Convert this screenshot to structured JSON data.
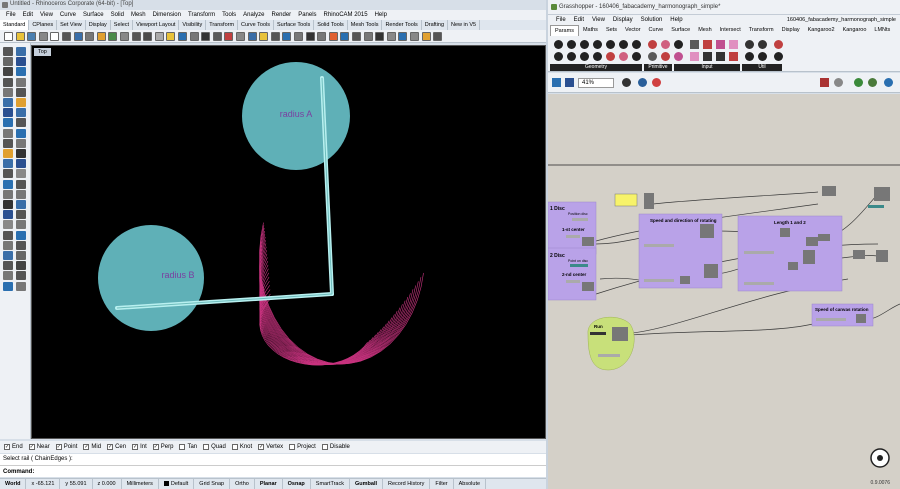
{
  "rhino": {
    "title": "Untitled - Rhinoceros Corporate (64-bit) - [Top]",
    "menu": [
      "File",
      "Edit",
      "View",
      "Curve",
      "Surface",
      "Solid",
      "Mesh",
      "Dimension",
      "Transform",
      "Tools",
      "Analyze",
      "Render",
      "Panels",
      "RhinoCAM 2015",
      "Help"
    ],
    "tabs": [
      "Standard",
      "CPlanes",
      "Set View",
      "Display",
      "Select",
      "Viewport Layout",
      "Visibility",
      "Transform",
      "Curve Tools",
      "Surface Tools",
      "Solid Tools",
      "Mesh Tools",
      "Render Tools",
      "Drafting",
      "New in V5"
    ],
    "active_tab": "Standard",
    "viewport_label": "Top",
    "circle_a_label": "radius A",
    "circle_b_label": "radius B",
    "osnaps": [
      {
        "label": "End",
        "checked": true
      },
      {
        "label": "Near",
        "checked": true
      },
      {
        "label": "Point",
        "checked": true
      },
      {
        "label": "Mid",
        "checked": true
      },
      {
        "label": "Cen",
        "checked": true
      },
      {
        "label": "Int",
        "checked": true
      },
      {
        "label": "Perp",
        "checked": true
      },
      {
        "label": "Tan",
        "checked": false
      },
      {
        "label": "Quad",
        "checked": false
      },
      {
        "label": "Knot",
        "checked": false
      },
      {
        "label": "Vertex",
        "checked": true
      },
      {
        "label": "Project",
        "checked": false
      },
      {
        "label": "Disable",
        "checked": false
      }
    ],
    "command_history": "Select rail ( ChainEdges ):",
    "command_prompt": "Command:",
    "status": {
      "cplane": "World",
      "x": "x -65.121",
      "y": "y 55.091",
      "z": "z 0.000",
      "units": "Millimeters",
      "layer": "Default",
      "toggles": [
        "Grid Snap",
        "Ortho",
        "Planar",
        "Osnap",
        "SmartTrack",
        "Gumball",
        "Record History",
        "Filter",
        "Absolute"
      ],
      "bold_toggles": [
        "Planar",
        "Osnap",
        "Gumball"
      ]
    },
    "colors": {
      "disc": "#5fb0b7",
      "disc_text": "#7a3fa0",
      "curve": "#c8337f",
      "arm": "#b8f0f0"
    }
  },
  "gh": {
    "title": "Grasshopper - 160406_fabacademy_harmonograph_simple*",
    "doc_title": "160406_fabacademy_harmonograph_simple",
    "menu": [
      "File",
      "Edit",
      "View",
      "Display",
      "Solution",
      "Help"
    ],
    "tabs": [
      "Params",
      "Maths",
      "Sets",
      "Vector",
      "Curve",
      "Surface",
      "Mesh",
      "Intersect",
      "Transform",
      "Display",
      "Kangaroo2",
      "Kangaroo",
      "LMNts"
    ],
    "active_tab": "Params",
    "ribbon_groups": [
      "Geometry",
      "Primitive",
      "Input",
      "Util"
    ],
    "zoom": "41%",
    "groups": {
      "disc1": "1 Disc",
      "disc1_sub": "Position disc",
      "disc1_center": "1-st center",
      "disc2": "2 Disc",
      "disc2_sub": "Point on disc",
      "disc2_center": "2-nd center",
      "speed": "Speed and direction of rotating",
      "length": "Length 1 and 2",
      "canvas_speed": "Speed of canvas rotation",
      "run": "Run"
    },
    "version": "0.9.0076",
    "colors": {
      "group": "#b9a2e8",
      "run_group": "#c8e07a",
      "panel": "#f7f36a",
      "wire": "#3a3a3a"
    }
  }
}
